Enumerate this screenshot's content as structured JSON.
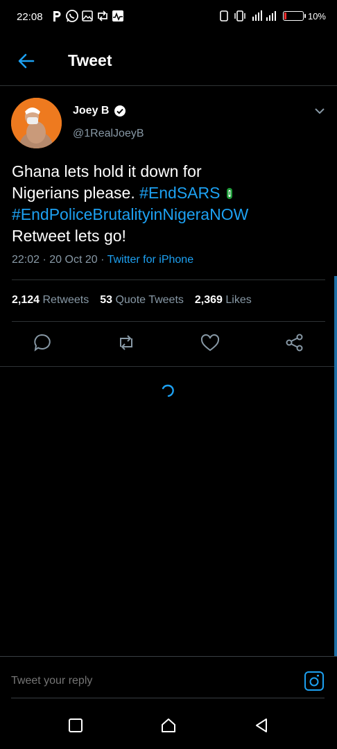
{
  "status_bar": {
    "time": "22:08",
    "battery_text": "10%",
    "battery_level": 0.1,
    "battery_color": "#ff2d2d"
  },
  "header": {
    "title": "Tweet",
    "back_icon": "arrow-left-icon"
  },
  "tweet": {
    "author_name": "Joey B",
    "author_handle": "@1RealJoeyB",
    "verified": true,
    "text_line1": "Ghana lets hold it down for",
    "text_line2_plain": "Nigerians please.",
    "hashtag1": "#EndSARS",
    "hashtag2": "#EndPoliceBrutalityinNigeraNOW",
    "text_line4": "Retweet lets go!",
    "time": "22:02",
    "date": "20 Oct 20",
    "source": "Twitter for iPhone",
    "separator": "·"
  },
  "stats": {
    "retweets_count": "2,124",
    "retweets_label": "Retweets",
    "quotes_count": "53",
    "quotes_label": "Quote Tweets",
    "likes_count": "2,369",
    "likes_label": "Likes"
  },
  "actions": [
    "reply-icon",
    "retweet-icon",
    "like-icon",
    "share-icon"
  ],
  "reply_bar": {
    "placeholder": "Tweet your reply",
    "camera_icon": "camera-icon"
  },
  "colors": {
    "accent": "#1da1f2",
    "secondary_text": "#8899a6",
    "background": "#000000",
    "divider": "#2f3336"
  }
}
